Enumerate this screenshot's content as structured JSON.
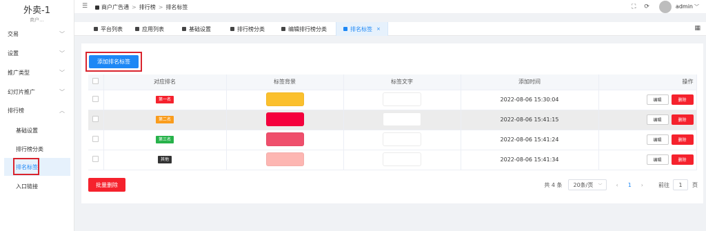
{
  "app": {
    "title": "外卖-1",
    "subtitle": "商户..."
  },
  "sidebar": {
    "items": [
      {
        "label": "交易",
        "chevron": "﹀"
      },
      {
        "label": "设置",
        "chevron": "﹀"
      },
      {
        "label": "推广类型",
        "chevron": "﹀"
      },
      {
        "label": "幻灯片推广",
        "chevron": "﹀"
      },
      {
        "label": "排行榜",
        "chevron": "︿"
      }
    ],
    "subitems": [
      {
        "label": "基础设置"
      },
      {
        "label": "排行榜分类"
      },
      {
        "label": "排名标签"
      },
      {
        "label": "入口链接"
      }
    ]
  },
  "header": {
    "breadcrumb": [
      "商户广告通",
      "排行榜",
      "排名标签"
    ],
    "separator": ">",
    "user": "admin"
  },
  "tabs": [
    {
      "label": "平台列表"
    },
    {
      "label": "应用列表"
    },
    {
      "label": "基础设置"
    },
    {
      "label": "排行榜分类"
    },
    {
      "label": "编辑排行榜分类"
    },
    {
      "label": "排名标签",
      "close": "×"
    }
  ],
  "main": {
    "add_button": "添加排名标签",
    "columns": [
      "对应排名",
      "标签背景",
      "标签文字",
      "添加时间",
      "操作"
    ],
    "rows": [
      {
        "rank": "第一名",
        "tag_color": "#f5222d",
        "bg": "#fbc02d",
        "added": "2022-08-06 15:30:04"
      },
      {
        "rank": "第二名",
        "tag_color": "#fa9c1c",
        "bg": "#f5003d",
        "added": "2022-08-06 15:41:15"
      },
      {
        "rank": "第三名",
        "tag_color": "#27b24a",
        "bg": "#ef4f6c",
        "added": "2022-08-06 15:41:24"
      },
      {
        "rank": "其他",
        "tag_color": "#333333",
        "bg": "#fdb6b2",
        "added": "2022-08-06 15:41:34"
      }
    ],
    "edit_label": "编辑",
    "delete_label": "删除",
    "batch_delete": "批量删除"
  },
  "pagination": {
    "total": "共 4 条",
    "page_size": "20条/页",
    "prev": "‹",
    "current": "1",
    "next": "›",
    "goto_label": "前往",
    "goto_value": "1",
    "goto_suffix": "页"
  },
  "colors": {
    "primary": "#1e88f5",
    "danger": "#f5222d",
    "highlight_row": "#ececec"
  }
}
